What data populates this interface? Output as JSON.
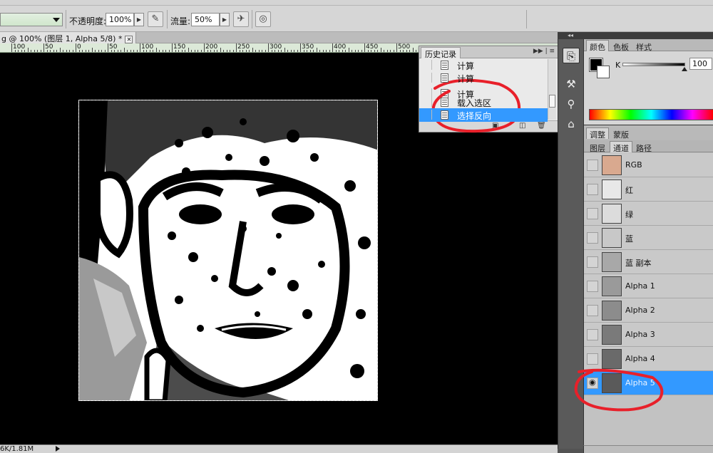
{
  "options_bar": {
    "opacity_label": "不透明度:",
    "opacity_value": "100%",
    "flow_label": "流量:",
    "flow_value": "50%",
    "airbrush_icon": "airbrush-icon",
    "tablet_icon": "tablet-pressure-icon"
  },
  "document": {
    "tab_title": "g @ 100% (图层 1, Alpha 5/8) *",
    "close_label": "✕"
  },
  "ruler": {
    "labels": [
      "100",
      "50",
      "0",
      "50",
      "100",
      "150",
      "200",
      "250",
      "300",
      "350",
      "400",
      "450",
      "500"
    ]
  },
  "history_panel": {
    "title": "历史记录",
    "items": [
      {
        "label": "计算",
        "selected": false
      },
      {
        "label": "计算",
        "selected": false
      },
      {
        "label": "计算",
        "selected": false
      },
      {
        "label": "载入选区",
        "selected": false
      },
      {
        "label": "选择反向",
        "selected": true
      }
    ]
  },
  "color_panel": {
    "tabs": [
      "颜色",
      "色板",
      "样式"
    ],
    "channel_label": "K",
    "channel_value": "100",
    "fg_color": "#000000",
    "bg_color": "#ffffff"
  },
  "adjust_panel": {
    "tabs": [
      "调整",
      "蒙版"
    ]
  },
  "layers_panel": {
    "tabs": [
      "图层",
      "通道",
      "路径"
    ],
    "channels": [
      {
        "name": "RGB",
        "visible": false,
        "selected": false
      },
      {
        "name": "红",
        "visible": false,
        "selected": false
      },
      {
        "name": "绿",
        "visible": false,
        "selected": false
      },
      {
        "name": "蓝",
        "visible": false,
        "selected": false
      },
      {
        "name": "蓝 副本",
        "visible": false,
        "selected": false
      },
      {
        "name": "Alpha 1",
        "visible": false,
        "selected": false
      },
      {
        "name": "Alpha 2",
        "visible": false,
        "selected": false
      },
      {
        "name": "Alpha 3",
        "visible": false,
        "selected": false
      },
      {
        "name": "Alpha 4",
        "visible": false,
        "selected": false
      },
      {
        "name": "Alpha 5",
        "visible": true,
        "selected": true
      }
    ]
  },
  "status_bar": {
    "doc_size": "6K/1.81M"
  },
  "colors": {
    "selection_blue": "#3399ff",
    "annotation_red": "#e8202a",
    "ruler_green": "#dce9d8"
  }
}
